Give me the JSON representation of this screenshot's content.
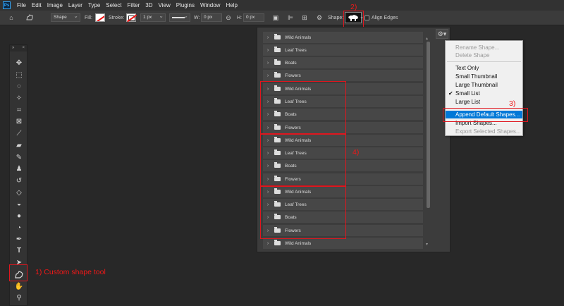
{
  "menubar": {
    "logo": "Ps",
    "items": [
      "File",
      "Edit",
      "Image",
      "Layer",
      "Type",
      "Select",
      "Filter",
      "3D",
      "View",
      "Plugins",
      "Window",
      "Help"
    ]
  },
  "options_bar": {
    "mode": "Shape",
    "fill_label": "Fill:",
    "stroke_label": "Stroke:",
    "stroke_width": "1 px",
    "w_label": "W:",
    "w_value": "0 px",
    "h_label": "H:",
    "h_value": "0 px",
    "shape_label": "Shape:",
    "align_edges": "Align Edges"
  },
  "tools_panel": {
    "header_left": "»",
    "header_right": "×",
    "tools": [
      "move-tool",
      "marquee-tool",
      "lasso-tool",
      "magic-wand-tool",
      "crop-tool",
      "frame-tool",
      "eyedropper-tool",
      "spot-healing-tool",
      "brush-tool",
      "clone-stamp-tool",
      "history-brush-tool",
      "eraser-tool",
      "gradient-tool",
      "blur-tool",
      "dodge-tool",
      "pen-tool",
      "type-tool",
      "path-selection-tool",
      "custom-shape-tool",
      "hand-tool",
      "zoom-tool"
    ]
  },
  "shapes_panel": {
    "groups": [
      "Wild Animals",
      "Leaf Trees",
      "Boats",
      "Flowers",
      "Wild Animals",
      "Leaf Trees",
      "Boats",
      "Flowers",
      "Wild Animals",
      "Leaf Trees",
      "Boats",
      "Flowers",
      "Wild Animals",
      "Leaf Trees",
      "Boats",
      "Flowers",
      "Wild Animals"
    ]
  },
  "context_menu": {
    "items": [
      {
        "label": "Rename Shape...",
        "state": "disabled"
      },
      {
        "label": "Delete Shape",
        "state": "disabled"
      },
      {
        "label": "Text Only",
        "state": "normal"
      },
      {
        "label": "Small Thumbnail",
        "state": "normal"
      },
      {
        "label": "Large Thumbnail",
        "state": "normal"
      },
      {
        "label": "Small List",
        "state": "checked"
      },
      {
        "label": "Large List",
        "state": "normal"
      },
      {
        "label": "Append Default Shapes...",
        "state": "selected"
      },
      {
        "label": "Import Shapes...",
        "state": "normal"
      },
      {
        "label": "Export Selected Shapes...",
        "state": "disabled"
      }
    ]
  },
  "annotations": {
    "step1": "1) Custom shape tool",
    "step2": "2)",
    "step3": "3)",
    "step4": "4)"
  },
  "colors": {
    "annotation": "#f01818",
    "menu_selected": "#0078d7"
  }
}
